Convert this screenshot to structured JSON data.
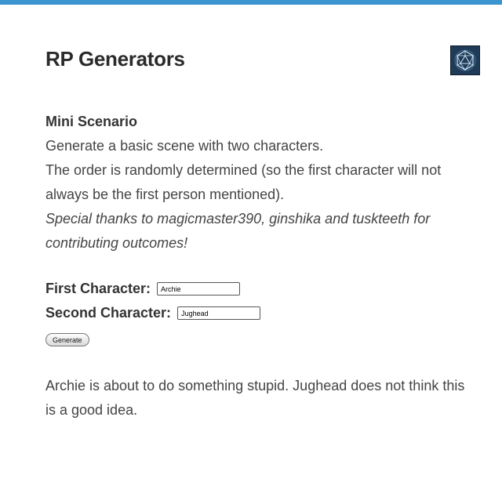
{
  "header": {
    "title": "RP Generators",
    "avatar_icon": "d20-dice-icon",
    "accent_color": "#3c94d1"
  },
  "scenario": {
    "title": "Mini Scenario",
    "description_lines": [
      "Generate a basic scene with two characters.",
      "The order is randomly determined (so the first character will not always be the first person mentioned)."
    ],
    "thanks": "Special thanks to magicmaster390, ginshika and tuskteeth for contributing outcomes!"
  },
  "form": {
    "first_label": "First Character:",
    "first_value": "Archie",
    "second_label": "Second Character:",
    "second_value": "Jughead",
    "generate_label": "Generate"
  },
  "result": {
    "text": "Archie is about to do something stupid. Jughead does not think this is a good idea."
  }
}
